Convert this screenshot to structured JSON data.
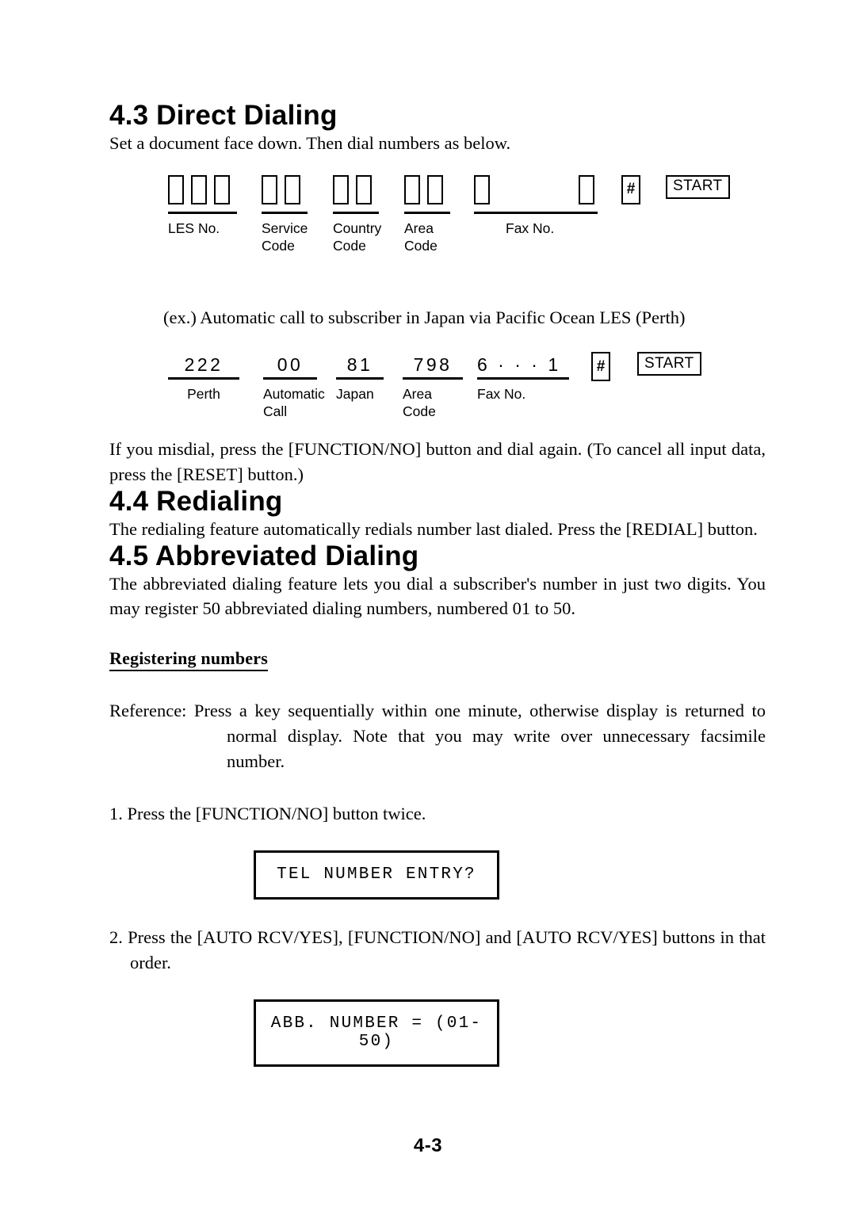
{
  "document": {
    "page_number": "4-3"
  },
  "sections": {
    "direct_dialing": {
      "heading": "4.3 Direct Dialing",
      "intro": "Set a document face down. Then dial numbers as below.",
      "example_caption": "(ex.) Automatic call to subscriber in Japan via Pacific Ocean LES (Perth)",
      "misdial_note": "If you misdial, press the [FUNCTION/NO] button and dial again. (To cancel all input data, press the [RESET] button.)"
    },
    "redialing": {
      "heading": "4.4 Redialing",
      "body": "The redialing feature automatically redials number last dialed. Press the [REDIAL] button."
    },
    "abbreviated_dialing": {
      "heading": "4.5 Abbreviated Dialing",
      "body": "The abbreviated dialing feature lets you dial a subscriber's number in just two digits. You may register 50 abbreviated dialing numbers, numbered 01 to 50.",
      "sub_heading": "Registering numbers",
      "reference_label": "Reference:",
      "reference_text": " Press a key sequentially within one minute, otherwise display is returned to normal display. Note that you may write over unnecessary facsimile number.",
      "step1": "1. Press the [FUNCTION/NO] button twice.",
      "step2": "2. Press the [AUTO RCV/YES], [FUNCTION/NO] and [AUTO RCV/YES] buttons in that order.",
      "lcd1": "TEL NUMBER ENTRY?",
      "lcd2": "ABB. NUMBER = (01-50)"
    }
  },
  "key_diagram": {
    "groups": [
      {
        "label": "LES No.",
        "boxes": 3,
        "label_line2": ""
      },
      {
        "label": "Service",
        "boxes": 2,
        "label_line2": "Code"
      },
      {
        "label": "Country",
        "boxes": 2,
        "label_line2": "Code"
      },
      {
        "label": "Area",
        "boxes": 2,
        "label_line2": "Code"
      },
      {
        "label": "Fax No.",
        "boxes": 2,
        "label_line2": ""
      }
    ],
    "hash_key": "#",
    "start_key": "START"
  },
  "example_diagram": {
    "groups": [
      {
        "digits": "222",
        "label": "Perth",
        "label_line2": ""
      },
      {
        "digits": "00",
        "label": "Automatic",
        "label_line2": "Call"
      },
      {
        "digits": "81",
        "label": "Japan",
        "label_line2": ""
      },
      {
        "digits": "798",
        "label": "Area",
        "label_line2": "Code"
      },
      {
        "digits": "6 · · · 1",
        "label": "Fax No.",
        "label_line2": ""
      }
    ],
    "hash_key": "#",
    "start_key": "START"
  }
}
